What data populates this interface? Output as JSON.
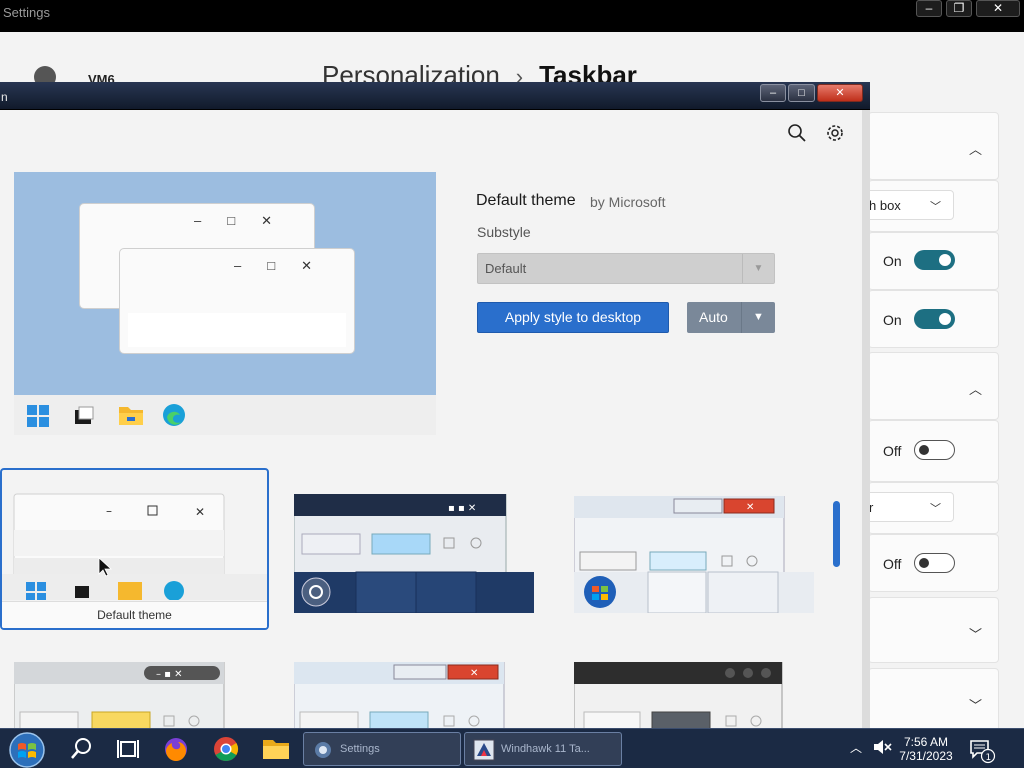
{
  "settings": {
    "title": "Settings",
    "account_name": "VM6",
    "breadcrumb": {
      "parent": "Personalization",
      "separator": "›",
      "current": "Taskbar"
    },
    "controls": {
      "minimize": "–",
      "maximize": "❐",
      "close": "✕"
    },
    "partial_dropdown_1": "h box",
    "partial_dropdown_2": "r",
    "toggles": [
      {
        "label": "On",
        "state": "on"
      },
      {
        "label": "On",
        "state": "on"
      },
      {
        "label": "Off",
        "state": "off"
      },
      {
        "label": "Off",
        "state": "off"
      }
    ]
  },
  "app": {
    "title": "n",
    "controls": {
      "minimize": "–",
      "maximize": "□",
      "close": "✕"
    },
    "theme": {
      "name": "Default theme",
      "author": "by Microsoft"
    },
    "substyle": {
      "label": "Substyle",
      "value": "Default"
    },
    "apply_button": "Apply style to desktop",
    "auto_button": "Auto",
    "mini_window_controls": "–□✕",
    "thumbnails": [
      {
        "caption": "Default theme",
        "selected": true
      }
    ]
  },
  "taskbar": {
    "tasks": [
      {
        "label": "Settings"
      },
      {
        "label": "Windhawk 11 Ta..."
      }
    ],
    "clock": {
      "time": "7:56 AM",
      "date": "7/31/2023"
    },
    "notification_count": "1"
  },
  "colors": {
    "accent": "#2a6fcc",
    "toggle_on": "#1d6f82",
    "preview_sky": "#9cbde0",
    "taskbar": "#1b2a44"
  },
  "icons": {
    "start": "windows-orb-icon",
    "search": "search-icon",
    "task_view": "task-view-icon",
    "firefox": "firefox-icon",
    "chrome": "chrome-icon",
    "explorer": "folder-icon",
    "settings": "gear-icon",
    "edge": "edge-icon"
  }
}
